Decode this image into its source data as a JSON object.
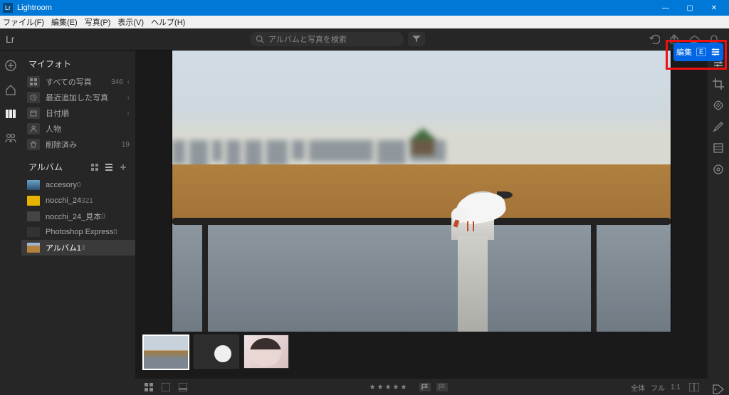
{
  "window": {
    "app_name": "Lightroom"
  },
  "menus": {
    "file": "ファイル(F)",
    "edit": "編集(E)",
    "photo": "写真(P)",
    "view": "表示(V)",
    "help": "ヘルプ(H)"
  },
  "logo": "Lr",
  "search": {
    "placeholder": "アルバムと写真を検索"
  },
  "my_photos_label": "マイフォト",
  "library": {
    "items": [
      {
        "label": "すべての写真",
        "count": "346",
        "chev": "‹"
      },
      {
        "label": "最近追加した写真",
        "count": "",
        "chev": "‹"
      },
      {
        "label": "日付順",
        "count": "",
        "chev": "‹"
      },
      {
        "label": "人物",
        "count": "",
        "chev": ""
      },
      {
        "label": "削除済み",
        "count": "19",
        "chev": ""
      }
    ]
  },
  "albums_label": "アルバム",
  "albums": [
    {
      "label": "accesory",
      "count": "0"
    },
    {
      "label": "nocchi_24",
      "count": "321"
    },
    {
      "label": "nocchi_24_見本",
      "count": "0"
    },
    {
      "label": "Photoshop Express",
      "count": "0"
    },
    {
      "label": "アルバム1",
      "count": "3"
    }
  ],
  "edit_button": {
    "label": "編集",
    "key": "E"
  },
  "bottom": {
    "stars": "★★★★★",
    "fit": "全体",
    "full": "フル",
    "one_to_one": "1:1"
  }
}
